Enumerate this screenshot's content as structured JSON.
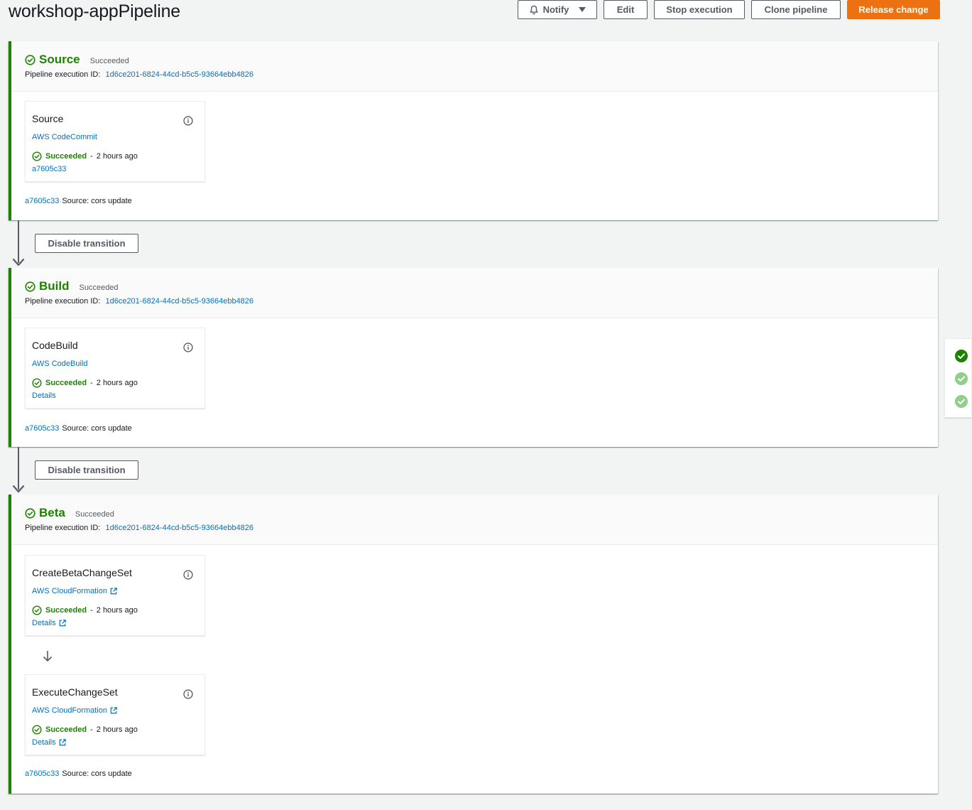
{
  "page": {
    "title": "workshop-appPipeline"
  },
  "toolbar": {
    "notify": "Notify",
    "edit": "Edit",
    "stop": "Stop execution",
    "clone": "Clone pipeline",
    "release": "Release change"
  },
  "colors": {
    "success": "#1d8102",
    "link": "#0073bb",
    "primary": "#ec7211",
    "success_light": "#8fcf89"
  },
  "transition_label": "Disable transition",
  "stages": [
    {
      "name": "Source",
      "status": "Succeeded",
      "exec_label": "Pipeline execution ID:",
      "exec_id": "1d6ce201-6824-44cd-b5c5-93664ebb4826",
      "actions": [
        {
          "name": "Source",
          "provider": "AWS CodeCommit",
          "status": "Succeeded",
          "separator": "-",
          "time": "2 hours ago",
          "link": "a7605c33"
        }
      ],
      "footer_commit": "a7605c33",
      "footer_msg": "Source: cors update"
    },
    {
      "name": "Build",
      "status": "Succeeded",
      "exec_label": "Pipeline execution ID:",
      "exec_id": "1d6ce201-6824-44cd-b5c5-93664ebb4826",
      "actions": [
        {
          "name": "CodeBuild",
          "provider": "AWS CodeBuild",
          "status": "Succeeded",
          "separator": "-",
          "time": "2 hours ago",
          "link": "Details"
        }
      ],
      "footer_commit": "a7605c33",
      "footer_msg": "Source: cors update"
    },
    {
      "name": "Beta",
      "status": "Succeeded",
      "exec_label": "Pipeline execution ID:",
      "exec_id": "1d6ce201-6824-44cd-b5c5-93664ebb4826",
      "actions": [
        {
          "name": "CreateBetaChangeSet",
          "provider": "AWS CloudFormation",
          "status": "Succeeded",
          "separator": "-",
          "time": "2 hours ago",
          "link": "Details"
        },
        {
          "name": "ExecuteChangeSet",
          "provider": "AWS CloudFormation",
          "status": "Succeeded",
          "separator": "-",
          "time": "2 hours ago",
          "link": "Details"
        }
      ],
      "footer_commit": "a7605c33",
      "footer_msg": "Source: cors update"
    }
  ]
}
